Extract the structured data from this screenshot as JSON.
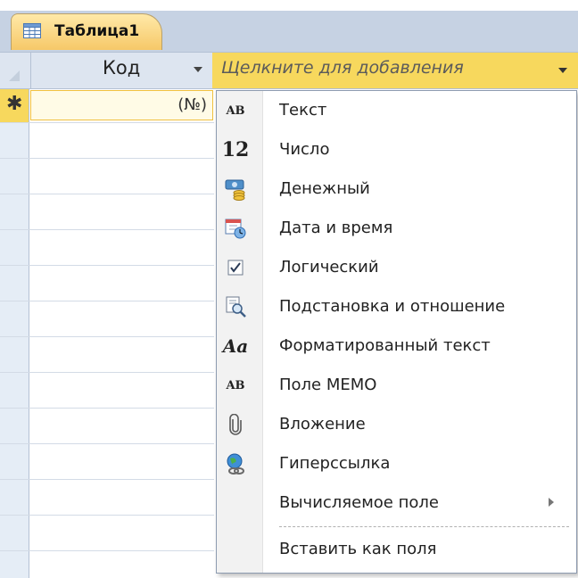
{
  "table_tab": {
    "label": "Таблица1",
    "icon": "table-icon"
  },
  "header": {
    "column_kod": "Код",
    "column_add": "Щелкните для добавления"
  },
  "new_row": {
    "marker": "✱",
    "value": "(№)"
  },
  "menu": {
    "items": [
      {
        "label": "Текст",
        "icon": "text-ab-icon",
        "icon_text": "AB"
      },
      {
        "label": "Число",
        "icon": "number-12-icon",
        "icon_text": "12"
      },
      {
        "label": "Денежный",
        "icon": "currency-icon"
      },
      {
        "label": "Дата и время",
        "icon": "calendar-clock-icon"
      },
      {
        "label": "Логический",
        "icon": "checkbox-icon"
      },
      {
        "label": "Подстановка и отношение",
        "icon": "lookup-icon"
      },
      {
        "label": "Форматированный текст",
        "icon": "rich-text-icon",
        "icon_text": "Aa"
      },
      {
        "label": "Поле МЕМО",
        "icon": "memo-ab-icon",
        "icon_text": "AB"
      },
      {
        "label": "Вложение",
        "icon": "paperclip-icon",
        "icon_text": "🖇"
      },
      {
        "label": "Гиперссылка",
        "icon": "hyperlink-globe-icon"
      },
      {
        "label": "Вычисляемое поле",
        "has_submenu": true
      },
      {
        "label": "Вставить как поля"
      }
    ]
  },
  "colors": {
    "accent_yellow": "#f7d85d",
    "header_blue": "#dde5f0",
    "tab_strip": "#c6d2e3"
  }
}
